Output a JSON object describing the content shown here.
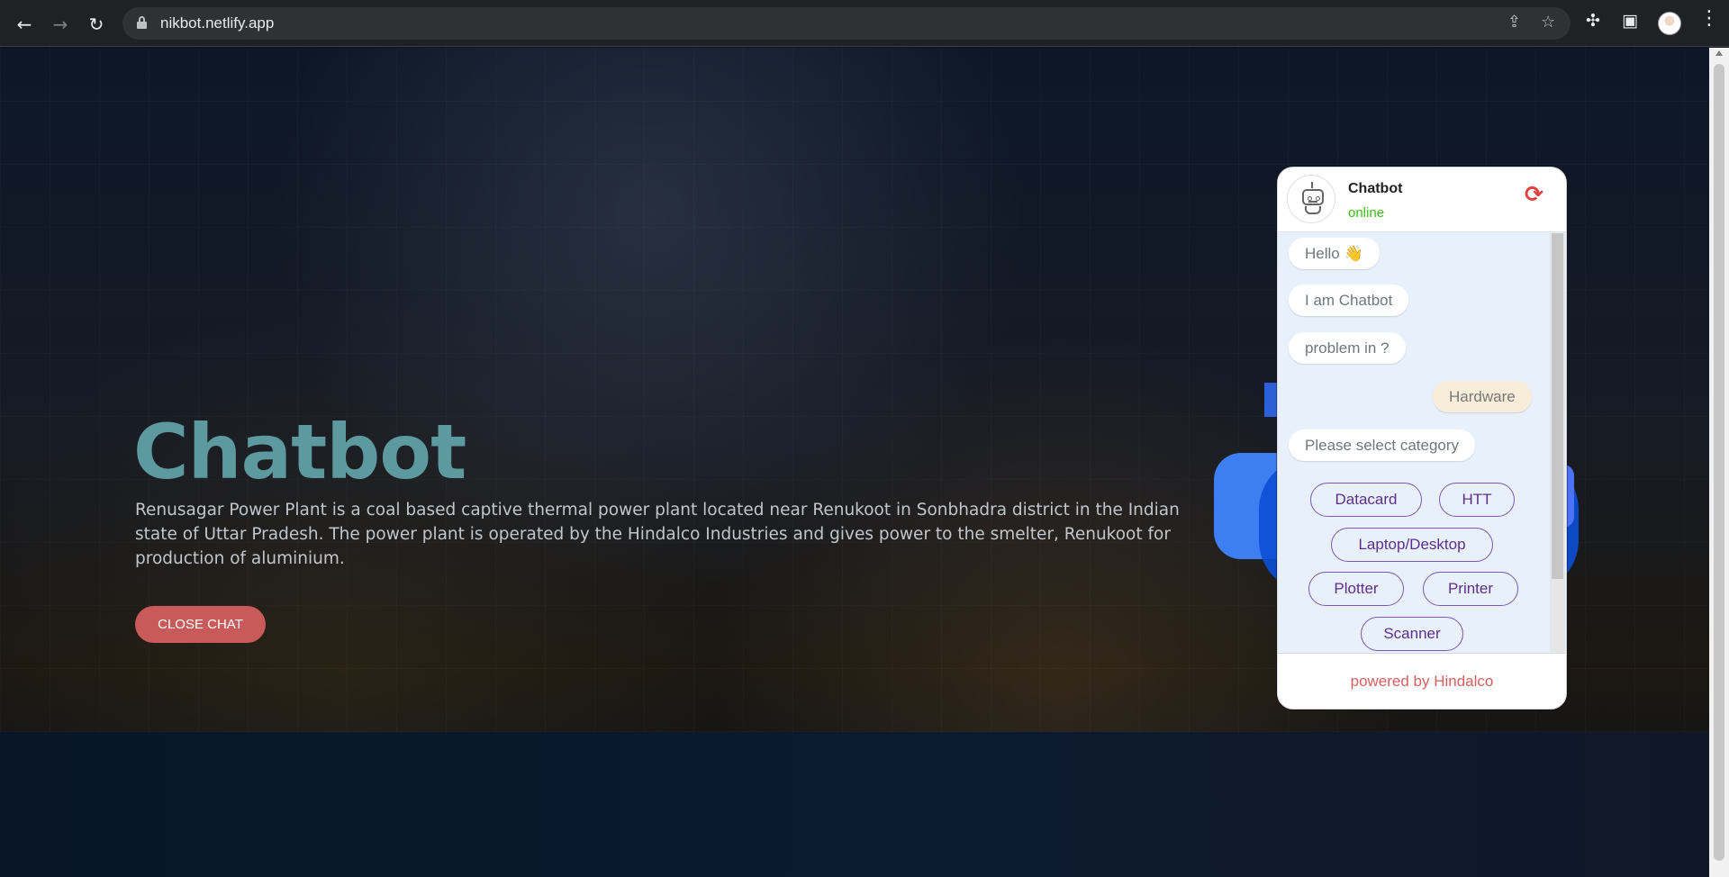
{
  "browser": {
    "url": "nikbot.netlify.app",
    "icons": [
      "back-icon",
      "forward-icon",
      "reload-icon",
      "lock-icon",
      "share-icon",
      "star-icon",
      "extensions-icon",
      "sidepanel-icon",
      "profile-avatar",
      "menu-icon"
    ]
  },
  "hero": {
    "title": "Chatbot",
    "description": "Renusagar Power Plant is a coal based captive thermal power plant located near Renukoot in Sonbhadra district in the Indian state of Uttar Pradesh. The power plant is operated by the Hindalco Industries and gives power to the smelter, Renukoot for production of aluminium.",
    "close_button": "CLOSE CHAT"
  },
  "chat": {
    "title": "Chatbot",
    "status": "online",
    "messages": [
      {
        "from": "bot",
        "text": "Hello 👋"
      },
      {
        "from": "bot",
        "text": "I am Chatbot"
      },
      {
        "from": "bot",
        "text": "problem in ?"
      },
      {
        "from": "user",
        "text": "Hardware"
      },
      {
        "from": "bot",
        "text": "Please select category"
      }
    ],
    "options": [
      "Datacard",
      "HTT",
      "Laptop/Desktop",
      "Plotter",
      "Printer",
      "Scanner"
    ],
    "footer": "powered by Hindalco"
  },
  "colors": {
    "hero_title": "#5c9a9f",
    "close_button": "#c95a5a",
    "status": "#3ebd15",
    "option_border": "#7f57b2",
    "footer_text": "#d56060"
  }
}
